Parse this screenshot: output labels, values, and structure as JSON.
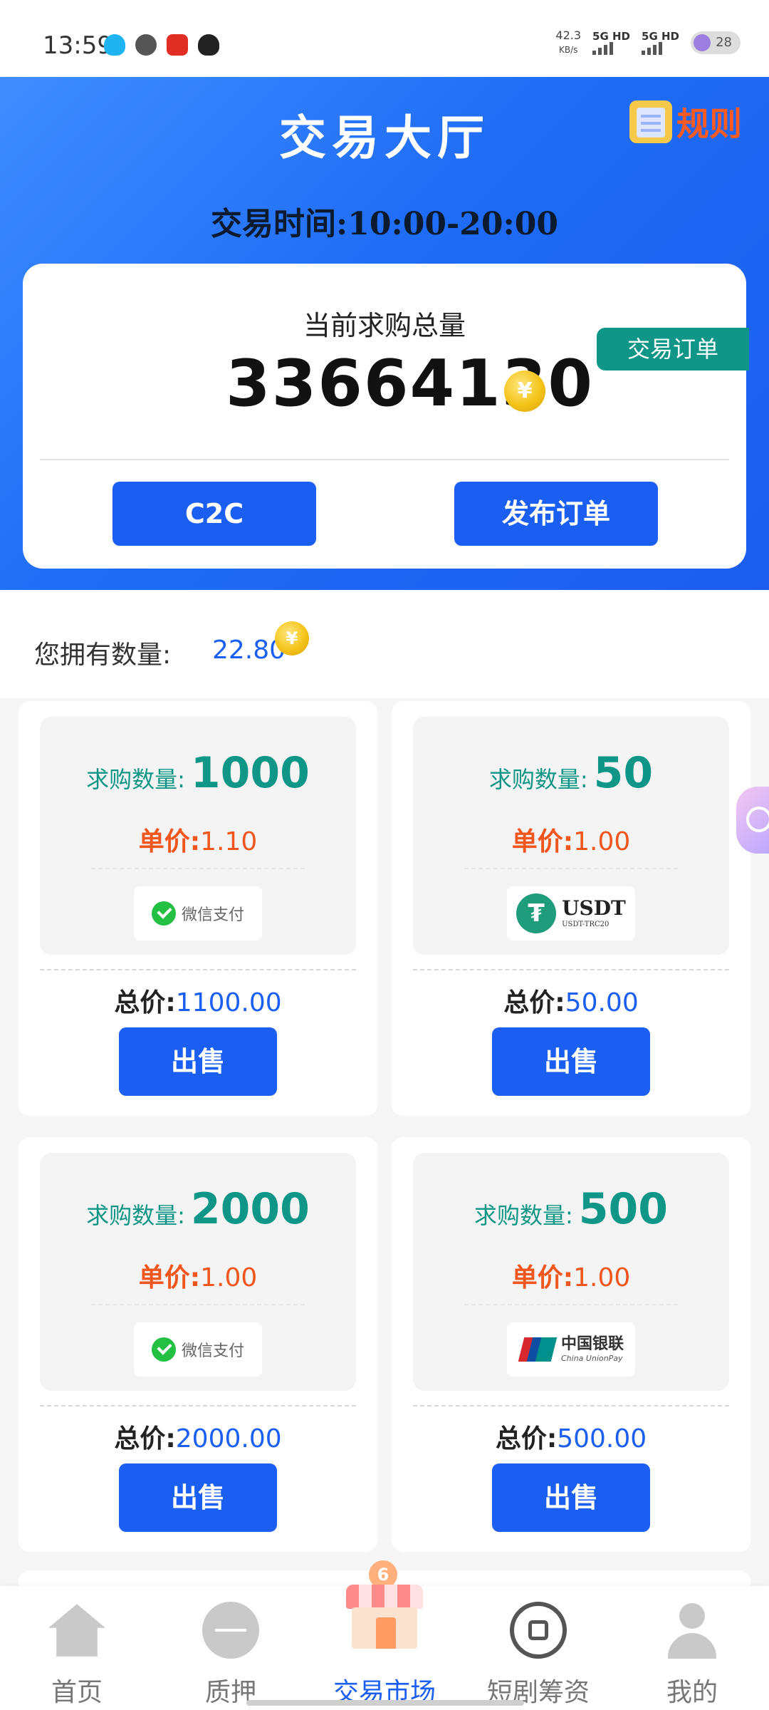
{
  "status_bar": {
    "time": "13:59",
    "speed_value": "42.3",
    "speed_unit": "KB/s",
    "net1": "5G HD",
    "net2": "5G HD",
    "battery": "28"
  },
  "header": {
    "title": "交易大厅",
    "rules_label": "规则",
    "trade_time": "交易时间:10:00-20:00"
  },
  "summary": {
    "label": "当前求购总量",
    "total": "33664130",
    "coin_symbol": "¥",
    "order_tab": "交易订单",
    "c2c_button": "C2C",
    "publish_button": "发布订单"
  },
  "holdings": {
    "label": "您拥有数量:",
    "value": "22.80"
  },
  "orders": [
    {
      "qty_label": "求购数量:",
      "qty": "1000",
      "price_label": "单价:",
      "price": "1.10",
      "payment": "微信支付",
      "total_label": "总价:",
      "total": "1100.00",
      "sell": "出售"
    },
    {
      "qty_label": "求购数量:",
      "qty": "50",
      "price_label": "单价:",
      "price": "1.00",
      "payment_main": "USDT",
      "payment_sub": "USDT-TRC20",
      "total_label": "总价:",
      "total": "50.00",
      "sell": "出售"
    },
    {
      "qty_label": "求购数量:",
      "qty": "2000",
      "price_label": "单价:",
      "price": "1.00",
      "payment": "微信支付",
      "total_label": "总价:",
      "total": "2000.00",
      "sell": "出售"
    },
    {
      "qty_label": "求购数量:",
      "qty": "500",
      "price_label": "单价:",
      "price": "1.00",
      "payment_main": "中国银联",
      "payment_sub": "China UnionPay",
      "total_label": "总价:",
      "total": "500.00",
      "sell": "出售"
    }
  ],
  "nav": {
    "home": "首页",
    "pledge": "质押",
    "market": "交易市场",
    "market_badge": "6",
    "drama": "短剧筹资",
    "me": "我的"
  },
  "colors": {
    "primary_blue": "#1a5ff2",
    "teal": "#0f9686",
    "orange": "#f0561e",
    "rules_orange": "#ff5a1f"
  }
}
